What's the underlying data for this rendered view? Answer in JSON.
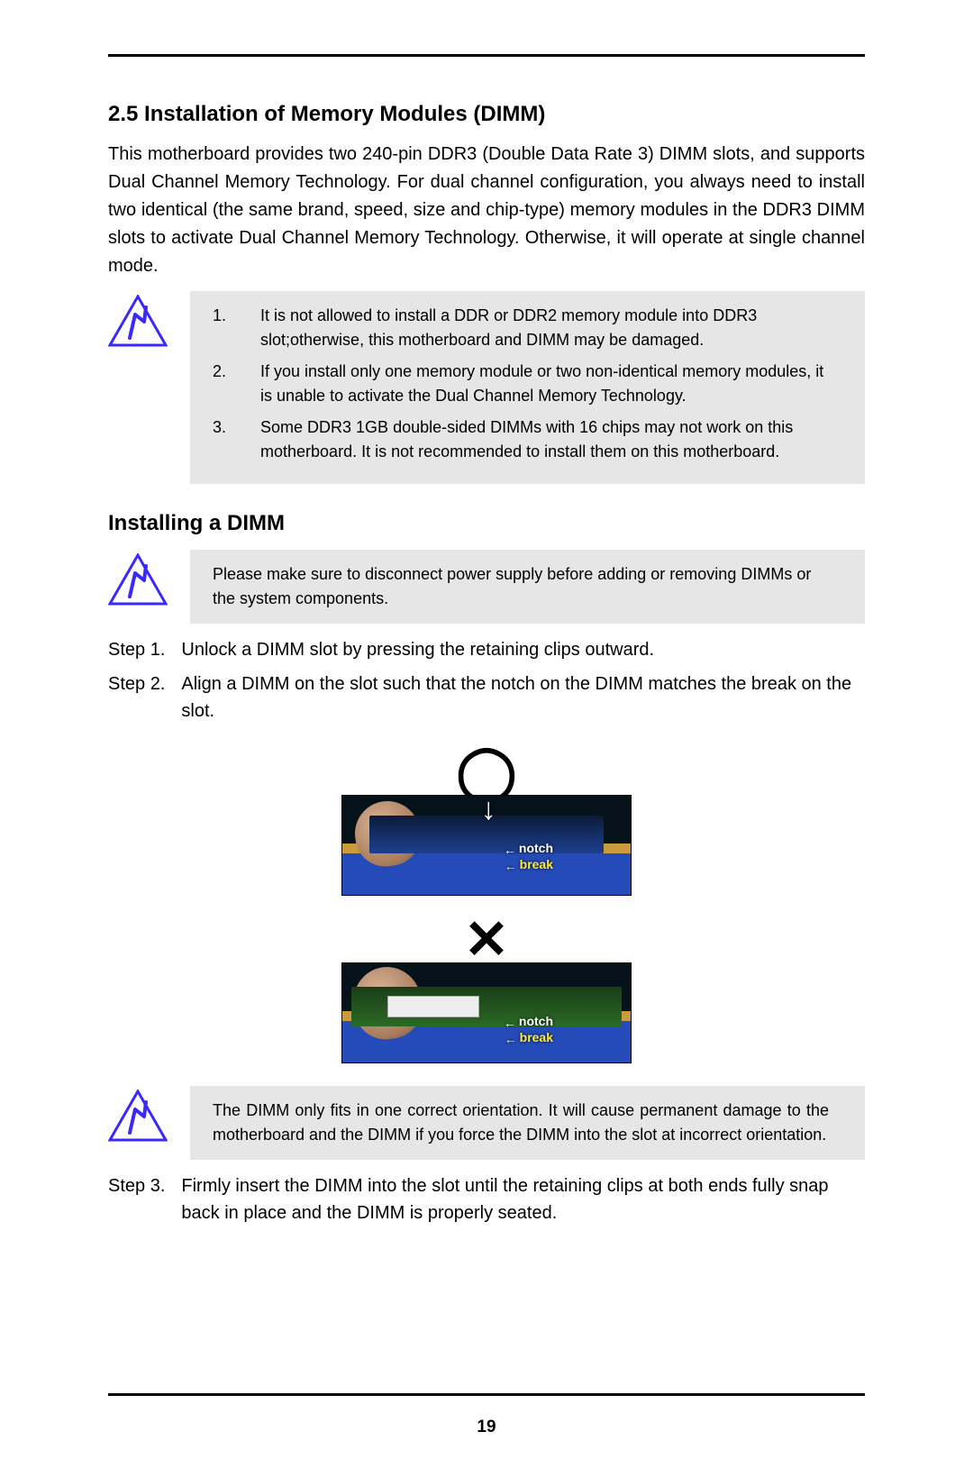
{
  "section_heading": "2.5  Installation of Memory Modules (DIMM)",
  "intro": "This motherboard provides two 240-pin DDR3 (Double Data Rate 3) DIMM slots, and supports Dual Channel Memory Technology. For dual channel configuration, you always need to install two identical (the same brand, speed, size and chip-type) memory modules in the DDR3 DIMM slots to activate Dual Channel Memory Technology. Otherwise, it will operate at single channel mode.",
  "notice1": {
    "items": [
      {
        "num": "1.",
        "text": "It is not allowed to install a DDR or DDR2 memory module into DDR3 slot;otherwise, this motherboard and DIMM may be damaged."
      },
      {
        "num": "2.",
        "text": "If you install only one memory module or two non-identical memory modules, it is unable to activate the Dual Channel Memory Technology."
      },
      {
        "num": "3.",
        "text": "Some DDR3 1GB double-sided DIMMs with 16 chips may not work on this motherboard. It is not recommended to install them on this motherboard."
      }
    ]
  },
  "sub_heading": "Installing a DIMM",
  "notice2": "Please make sure to disconnect power supply before adding or removing DIMMs or the system components.",
  "steps_a": [
    {
      "label": "Step 1.",
      "text": "Unlock a DIMM slot by pressing the retaining clips outward."
    },
    {
      "label": "Step 2.",
      "text": "Align a DIMM on the slot such that the notch on the DIMM matches the break on the slot."
    }
  ],
  "figure": {
    "correct_mark": "◯",
    "wrong_mark": "✕",
    "label_notch_prefix": "←",
    "label_notch": "notch",
    "label_break_prefix": "←",
    "label_break": "break",
    "down_arrow": "↓"
  },
  "notice3": "The DIMM only fits in one correct orientation. It will cause permanent damage to the motherboard and the DIMM if you force the DIMM into the slot at incorrect orientation.",
  "steps_b": [
    {
      "label": "Step 3.",
      "text": "Firmly insert the DIMM into the slot until the retaining clips at both ends fully snap back in place and the DIMM is properly seated."
    }
  ],
  "page_number": "19"
}
